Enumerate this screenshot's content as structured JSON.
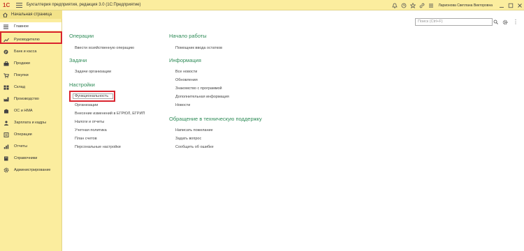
{
  "window": {
    "title": "Бухгалтерия предприятия, редакция 3.0  (1С:Предприятие)",
    "logo": "1С",
    "user": "Ларионова Светлана Викторовна"
  },
  "titlebar_icons": [
    "bell-icon",
    "history-icon",
    "star-icon",
    "link-icon",
    "list-icon",
    "minimize-icon",
    "maximize-icon",
    "close-icon"
  ],
  "sidebar": {
    "home_label": "Начальная страница",
    "items": [
      {
        "label": "Главное",
        "icon": "menu-icon",
        "active": true
      },
      {
        "label": "Руководителю",
        "icon": "chart-icon"
      },
      {
        "label": "Банк и касса",
        "icon": "bank-icon"
      },
      {
        "label": "Продажи",
        "icon": "sales-icon"
      },
      {
        "label": "Покупки",
        "icon": "cart-icon"
      },
      {
        "label": "Склад",
        "icon": "warehouse-icon"
      },
      {
        "label": "Производство",
        "icon": "production-icon"
      },
      {
        "label": "ОС и НМА",
        "icon": "assets-icon"
      },
      {
        "label": "Зарплата и кадры",
        "icon": "people-icon"
      },
      {
        "label": "Операции",
        "icon": "operations-icon"
      },
      {
        "label": "Отчеты",
        "icon": "reports-icon"
      },
      {
        "label": "Справочники",
        "icon": "reference-icon"
      },
      {
        "label": "Администрирование",
        "icon": "admin-icon"
      }
    ]
  },
  "search": {
    "placeholder": "Поиск (Ctrl+F)"
  },
  "left_column": {
    "operations": {
      "title": "Операции",
      "links": [
        "Ввести хозяйственную операцию"
      ]
    },
    "tasks": {
      "title": "Задачи",
      "links": [
        "Задачи организации"
      ]
    },
    "settings": {
      "title": "Настройки",
      "links": [
        "Функциональность",
        "Организации",
        "Внесение изменений в ЕГРЮЛ, ЕГРИП",
        "Налоги и отчеты",
        "Учетная политика",
        "План счетов",
        "Персональные настройки"
      ]
    }
  },
  "right_column": {
    "start": {
      "title": "Начало работы",
      "links": [
        "Помощник ввода остатков"
      ]
    },
    "info": {
      "title": "Информация",
      "links": [
        "Все новости",
        "Обновления",
        "Знакомство с программой",
        "Дополнительная информация",
        "Новости"
      ]
    },
    "support": {
      "title": "Обращение в техническую поддержку",
      "links": [
        "Написать пожелание",
        "Задать вопрос",
        "Сообщить об ошибке"
      ]
    }
  },
  "colors": {
    "accent_yellow": "#fbed9e",
    "section_green": "#2e8b57",
    "highlight_red": "#d9242f",
    "logo_red": "#c8392b"
  }
}
